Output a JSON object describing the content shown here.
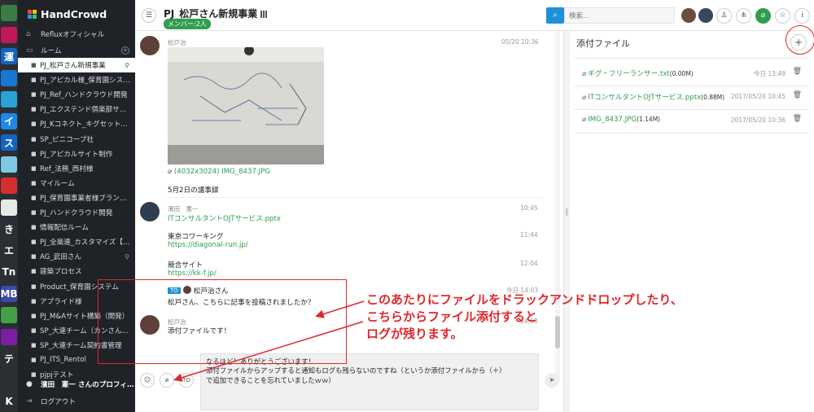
{
  "app_strip": [
    {
      "label": "",
      "color": "#3a7d44"
    },
    {
      "label": "",
      "color": "#c2185b"
    },
    {
      "label": "運",
      "color": "#1565c0"
    },
    {
      "label": "",
      "color": "#1976d2"
    },
    {
      "label": "",
      "color": "#29a3d6"
    },
    {
      "label": "イ",
      "color": "#1e88e5"
    },
    {
      "label": "ス",
      "color": "#1565c0"
    },
    {
      "label": "",
      "color": "#7ec8e3"
    },
    {
      "label": "",
      "color": "#d32f2f"
    },
    {
      "label": "",
      "color": "#e8e8e8"
    },
    {
      "label": "き",
      "color": "#2b2f34"
    },
    {
      "label": "エ",
      "color": "#2b2f34"
    },
    {
      "label": "Tn",
      "color": "#2b2f34"
    },
    {
      "label": "MB",
      "color": "#3949ab"
    },
    {
      "label": "",
      "color": "#43a047"
    },
    {
      "label": "",
      "color": "#7b1fa2"
    },
    {
      "label": "テ",
      "color": "#2b2f34"
    },
    {
      "label": "",
      "color": "#2b2f34"
    },
    {
      "label": "K",
      "color": "#2b2f34"
    }
  ],
  "sidebar": {
    "brand": "HandCrowd",
    "org": "Refluxオフィシャル",
    "rooms_header": "ルーム",
    "rooms": [
      {
        "label": "PJ_松戸さん新規事業",
        "active": true,
        "pinned": true
      },
      {
        "label": "PJ_アピカル様_保育園シス…",
        "active": false,
        "pinned": false
      },
      {
        "label": "PJ_Ref_ハンドクラウド開発",
        "active": false,
        "pinned": false
      },
      {
        "label": "PJ_エクステンド倶楽部サイ…",
        "active": false,
        "pinned": false
      },
      {
        "label": "PJ_Kコネクト_キグセット…",
        "active": false,
        "pinned": false
      },
      {
        "label": "SP_ピニコープ社",
        "active": false,
        "pinned": false
      },
      {
        "label": "PJ_アピカルサイト制作",
        "active": false,
        "pinned": false
      },
      {
        "label": "Ref_法務_西村様",
        "active": false,
        "pinned": false
      },
      {
        "label": "マイルーム",
        "active": false,
        "pinned": false
      },
      {
        "label": "PJ_保育園事業者様ブランデ…",
        "active": false,
        "pinned": false
      },
      {
        "label": "PJ_ハンドクラウド開発",
        "active": false,
        "pinned": false
      },
      {
        "label": "情報配信ルーム",
        "active": false,
        "pinned": false
      },
      {
        "label": "PJ_全楽連_カスタマイズ【…",
        "active": false,
        "pinned": false
      },
      {
        "label": "AG_武田さん",
        "active": false,
        "pinned": true
      },
      {
        "label": "建築プロセス",
        "active": false,
        "pinned": false
      },
      {
        "label": "Product_保育園システム",
        "active": false,
        "pinned": false
      },
      {
        "label": "アプライド様",
        "active": false,
        "pinned": false
      },
      {
        "label": "PJ_M&Aサイト構築（開発）",
        "active": false,
        "pinned": false
      },
      {
        "label": "SP_大連チーム（カンさん、…",
        "active": false,
        "pinned": false
      },
      {
        "label": "SP_大連チーム契約書管理",
        "active": false,
        "pinned": false
      },
      {
        "label": "PJ_ITS_Rentol",
        "active": false,
        "pinned": false
      },
      {
        "label": "pjpjテスト",
        "active": false,
        "pinned": false
      }
    ],
    "profile": "濱田　憲一 さんのプロフィ…",
    "logout": "ログアウト"
  },
  "header": {
    "title": "PJ_松戸さん新規事業",
    "members": "メンバー:2人",
    "search_placeholder": "検索..."
  },
  "messages": {
    "m1": {
      "sender": "松戸治",
      "time": "05/20 10:36",
      "attachment": "(4032x3024) IMG_8437.JPG",
      "text": "5月2日の議事録"
    },
    "m2": {
      "sender": "濱田　憲一",
      "time": "10:45",
      "link": "ITコンサルタントOJTサービス.pptx"
    },
    "m3": {
      "text": "東京コワーキング",
      "link": "https://diagonal-run.jp/",
      "time": "11:44"
    },
    "m4": {
      "text": "競合サイト",
      "link": "https://kk-f.jp/",
      "time": "12:04"
    },
    "m5": {
      "to": "TO",
      "to_name": "松戸治さん",
      "text": "松戸さん、こちらに記事を投稿されましたか？",
      "time": "今日 14:03"
    },
    "m6": {
      "sender": "松戸治",
      "text": "添付ファイルです！",
      "time": "14:58"
    }
  },
  "composer": {
    "line1": "なるほど！ありがとうございます！",
    "line2": "添付ファイルからアップすると通知もログも残らないのですね（というか添付ファイルから（＋）",
    "line3": "で追加できることを忘れていましたｗｗ）",
    "to_label": "TO"
  },
  "right_panel": {
    "title": "添付ファイル",
    "files": [
      {
        "name": "ギグ・フリーランサー.txt",
        "size": "(0.00M)",
        "date": "今日 13:49"
      },
      {
        "name": "ITコンサルタントOJTサービス.pptx",
        "size": "(0.88M)",
        "date": "2017/05/20 10:45"
      },
      {
        "name": "IMG_8437.JPG",
        "size": "(1.14M)",
        "date": "2017/05/20 10:36"
      }
    ]
  },
  "annotation": {
    "line1": "このあたりにファイルをドラックアンドドロップしたり、",
    "line2": "こちらからファイル添付すると",
    "line3": "ログが残ります。",
    "color": "#e0262b"
  },
  "colors": {
    "accent_green": "#2e9e4f",
    "accent_blue": "#1e90d8",
    "sidebar_bg": "#1f2328"
  }
}
